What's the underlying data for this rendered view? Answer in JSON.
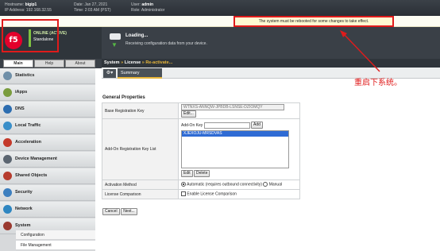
{
  "topbar": {
    "hostname_label": "Hostname:",
    "hostname": "bigip1",
    "ip_label": "IP Address:",
    "ip": "192.168.32.55",
    "date_label": "Date:",
    "date": "Jan 27, 2021",
    "time_label": "Time:",
    "time": "2:03 AM (PST)",
    "user_label": "User:",
    "user": "admin",
    "role_label": "Role:",
    "role": "Administrator"
  },
  "reboot_message": "The system must be rebooted for some changes to take effect.",
  "status": {
    "online": "ONLINE (ACTIVE)",
    "mode": "Standalone"
  },
  "logo": "f5",
  "loading": {
    "title": "Loading...",
    "subtitle": "Receiving configuration data from your device."
  },
  "side_tabs": [
    "Main",
    "Help",
    "About"
  ],
  "nav": {
    "items": [
      {
        "label": "Statistics",
        "icon": "statistics-icon",
        "color": "#6f8fa8"
      },
      {
        "label": "iApps",
        "icon": "iapps-icon",
        "color": "#7a9c3e"
      },
      {
        "label": "DNS",
        "icon": "dns-icon",
        "color": "#2c6db0"
      },
      {
        "label": "Local Traffic",
        "icon": "local-traffic-icon",
        "color": "#3a8fc9"
      },
      {
        "label": "Acceleration",
        "icon": "acceleration-icon",
        "color": "#c43a2b"
      },
      {
        "label": "Device Management",
        "icon": "device-management-icon",
        "color": "#5b6570"
      },
      {
        "label": "Shared Objects",
        "icon": "shared-objects-icon",
        "color": "#b63c2e"
      },
      {
        "label": "Security",
        "icon": "security-icon",
        "color": "#3d7fbf"
      },
      {
        "label": "Network",
        "icon": "network-icon",
        "color": "#2e86c1"
      },
      {
        "label": "System",
        "icon": "system-icon",
        "color": "#9a3a30"
      }
    ],
    "sub_items": [
      "Configuration",
      "File Management"
    ]
  },
  "breadcrumb": {
    "part1": "System",
    "part2": "License",
    "part3": "Re-activate...",
    "sep": "»"
  },
  "subtab": "Summary",
  "form": {
    "section_title": "General Properties",
    "base_key_label": "Base Registration Key",
    "base_key_value": "WTNXS-ANNQW-JPBDB-LSNSE-DZIOMQY",
    "edit_label": "Edit...",
    "addon_label": "Add-On Registration Key List",
    "addon_key_label": "Add-On Key",
    "add_label": "Add",
    "addon_list": [
      "XJEXOJU-MRSDVAS"
    ],
    "list_edit_label": "Edit",
    "list_delete_label": "Delete",
    "activation_label": "Activation Method",
    "activation_auto": "Automatic (requires outbound connectivity)",
    "activation_manual": "Manual",
    "license_compare_label": "License Comparison",
    "license_compare_option": "Enable License Comparison"
  },
  "buttons": {
    "cancel": "Cancel",
    "next": "Next..."
  },
  "annotation": "重启下系统。",
  "colors": {
    "accent": "#e8b63a",
    "annotation": "#e01b1b",
    "brand": "#e4002b"
  }
}
